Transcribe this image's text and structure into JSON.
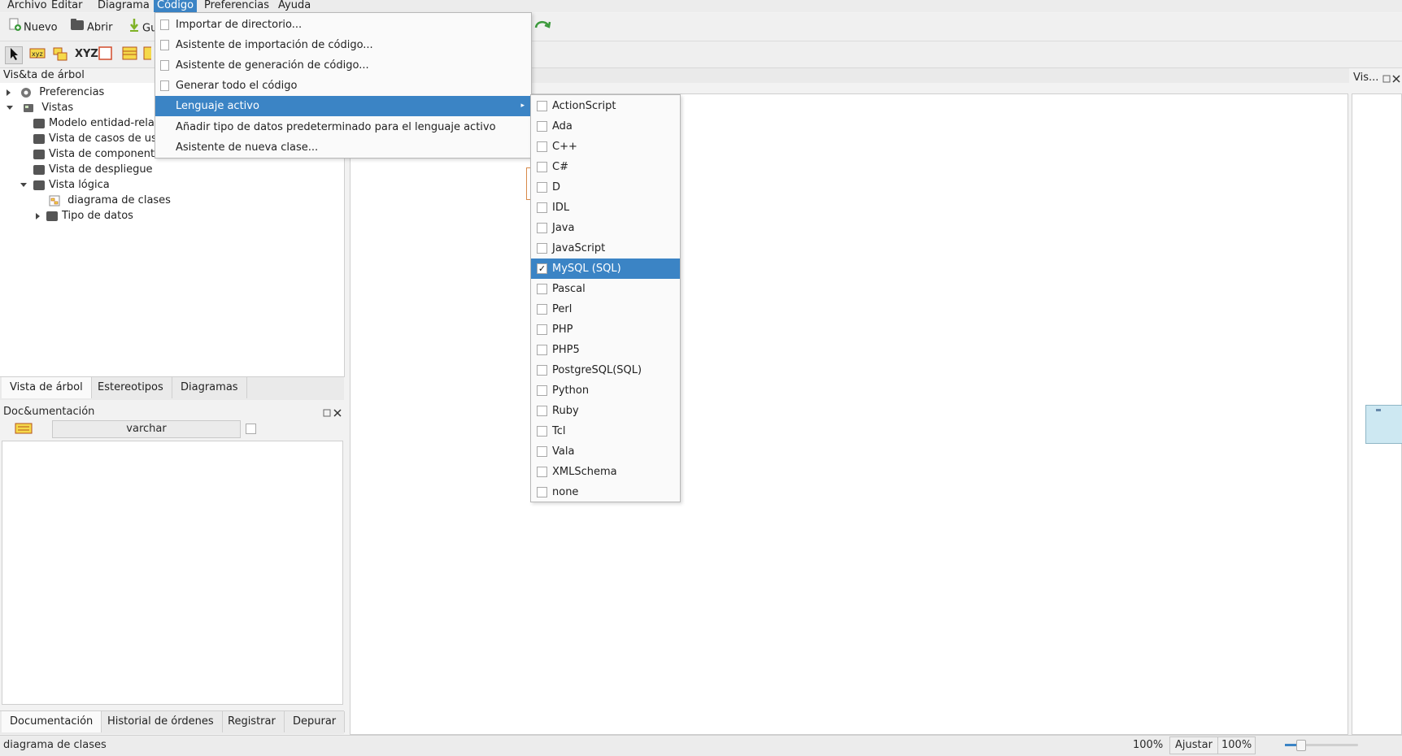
{
  "menubar": {
    "items": [
      "Archivo",
      "Editar",
      "Diagrama",
      "Código",
      "Preferencias",
      "Ayuda"
    ]
  },
  "toolbar": {
    "new_label": "Nuevo",
    "open_label": "Abrir",
    "save_label": "Gu"
  },
  "toolrow": {
    "xyz_label": "XYZ"
  },
  "tree": {
    "title": "Vis&ta de árbol",
    "nodes": [
      "Preferencias",
      "Vistas",
      "Modelo entidad-rela",
      "Vista de casos de uso",
      "Vista de componentes",
      "Vista de despliegue",
      "Vista lógica",
      "diagrama de clases",
      "Tipo de datos"
    ]
  },
  "tree_tabs": [
    "Vista de árbol",
    "Estereotipos",
    "Diagramas"
  ],
  "doc": {
    "title": "Doc&umentación",
    "field_value": "varchar"
  },
  "doc_tabs": [
    "Documentación",
    "Historial de órdenes",
    "Registrar",
    "Depurar"
  ],
  "bird_view": {
    "title": "Vis..."
  },
  "codigo_menu": {
    "items": [
      "Importar de directorio...",
      "Asistente de importación de código...",
      "Asistente de generación de código...",
      "Generar todo el código",
      "Lenguaje activo",
      "Añadir tipo de datos predeterminado para el lenguaje activo",
      "Asistente de nueva clase..."
    ],
    "highlighted": "Lenguaje activo"
  },
  "language_menu": {
    "items": [
      {
        "label": "ActionScript",
        "checked": false
      },
      {
        "label": "Ada",
        "checked": false
      },
      {
        "label": "C++",
        "checked": false
      },
      {
        "label": "C#",
        "checked": false
      },
      {
        "label": "D",
        "checked": false
      },
      {
        "label": "IDL",
        "checked": false
      },
      {
        "label": "Java",
        "checked": false
      },
      {
        "label": "JavaScript",
        "checked": false
      },
      {
        "label": "MySQL (SQL)",
        "checked": true
      },
      {
        "label": "Pascal",
        "checked": false
      },
      {
        "label": "Perl",
        "checked": false
      },
      {
        "label": "PHP",
        "checked": false
      },
      {
        "label": "PHP5",
        "checked": false
      },
      {
        "label": "PostgreSQL(SQL)",
        "checked": false
      },
      {
        "label": "Python",
        "checked": false
      },
      {
        "label": "Ruby",
        "checked": false
      },
      {
        "label": "Tcl",
        "checked": false
      },
      {
        "label": "Vala",
        "checked": false
      },
      {
        "label": "XMLSchema",
        "checked": false
      },
      {
        "label": "none",
        "checked": false
      }
    ],
    "check_mark": "✓"
  },
  "statusbar": {
    "message": "diagrama de clases",
    "zoom": "100%",
    "fit_label": "Ajustar",
    "zoom2": "100%"
  },
  "colors": {
    "highlight": "#3b84c5",
    "bird_view_box": "#cde8f2"
  }
}
